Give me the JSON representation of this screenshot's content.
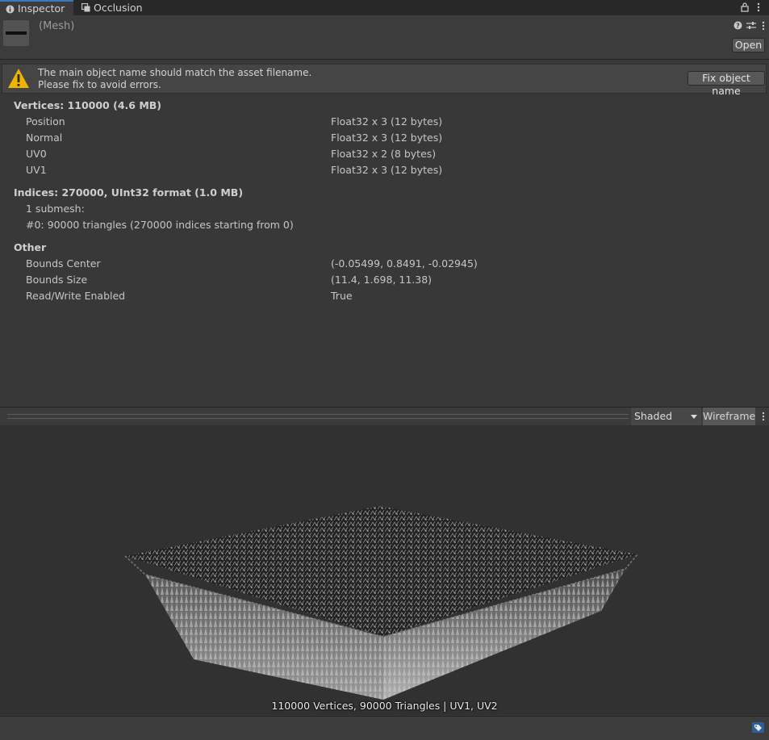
{
  "tabs": [
    {
      "label": "Inspector",
      "icon": "info-icon"
    },
    {
      "label": "Occlusion",
      "icon": "occlusion-icon"
    }
  ],
  "header": {
    "title": "(Mesh)",
    "open_button": "Open"
  },
  "warning": {
    "line1": "The main object name should match the asset filename.",
    "line2": "Please fix to avoid errors.",
    "fix_button": "Fix object name"
  },
  "vertices": {
    "heading": "Vertices: 110000 (4.6 MB)",
    "rows": [
      {
        "label": "Position",
        "value": "Float32 x 3 (12 bytes)"
      },
      {
        "label": "Normal",
        "value": "Float32 x 3 (12 bytes)"
      },
      {
        "label": "UV0",
        "value": "Float32 x 2 (8 bytes)"
      },
      {
        "label": "UV1",
        "value": "Float32 x 3 (12 bytes)"
      }
    ]
  },
  "indices": {
    "heading": "Indices: 270000, UInt32 format (1.0 MB)",
    "submesh_count": "1 submesh:",
    "submesh_detail": "#0: 90000 triangles (270000 indices starting from 0)"
  },
  "other": {
    "heading": "Other",
    "rows": [
      {
        "label": "Bounds Center",
        "value": "(-0.05499, 0.8491, -0.02945)"
      },
      {
        "label": "Bounds Size",
        "value": "(11.4, 1.698, 11.38)"
      },
      {
        "label": "Read/Write Enabled",
        "value": "True"
      }
    ]
  },
  "preview": {
    "shading_mode": "Shaded",
    "wireframe_button": "Wireframe",
    "caption": "110000 Vertices, 90000 Triangles | UV1, UV2"
  },
  "colors": {
    "accent": "#3a79bb",
    "warning": "#f0b400",
    "background": "#383838"
  }
}
